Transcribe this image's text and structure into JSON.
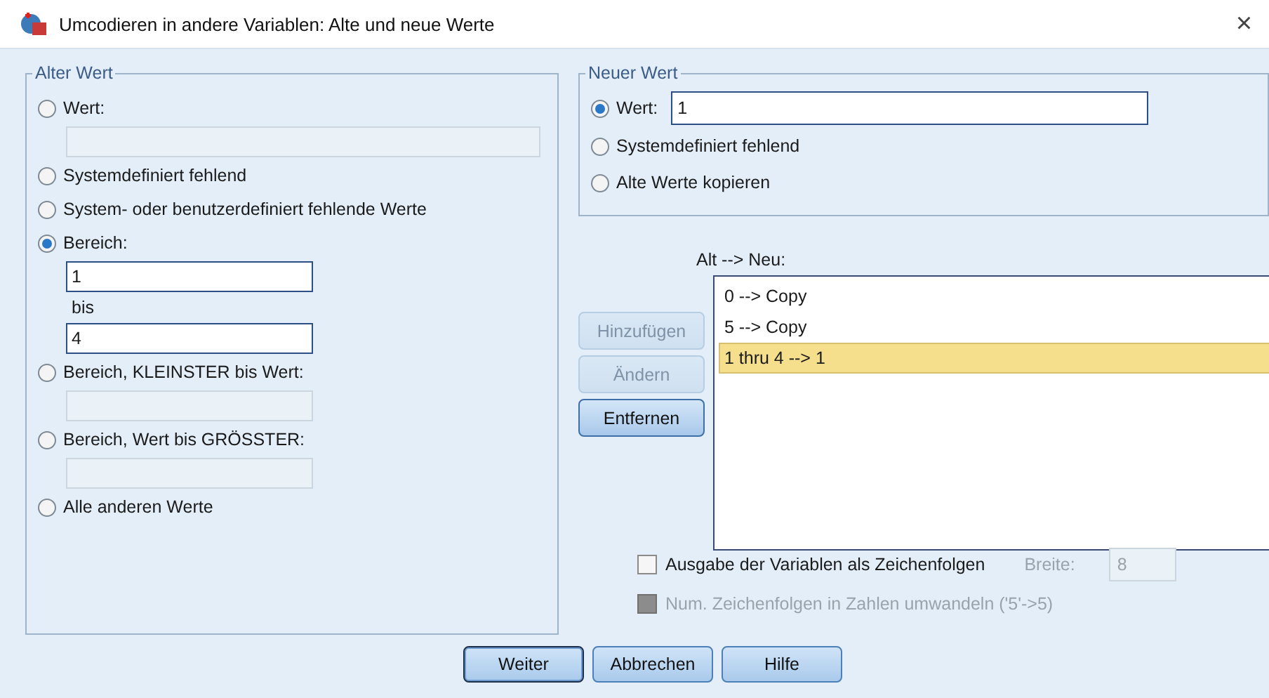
{
  "window": {
    "title": "Umcodieren in andere Variablen: Alte und neue Werte",
    "close": "×"
  },
  "old_value": {
    "title": "Alter Wert",
    "items": [
      {
        "kind": "radio",
        "label": "Wert:",
        "selected": false
      },
      {
        "kind": "field",
        "disabled": true,
        "wide": true
      },
      {
        "kind": "radio",
        "label": "Systemdefiniert fehlend",
        "selected": false
      },
      {
        "kind": "radio",
        "label": "System- oder benutzerdefiniert fehlende Werte",
        "selected": false
      },
      {
        "kind": "radio",
        "label": "Bereich:",
        "selected": true
      },
      {
        "kind": "field",
        "value": "1",
        "disabled": false,
        "wide": false
      },
      {
        "kind": "label",
        "label": "bis"
      },
      {
        "kind": "field",
        "value": "4",
        "disabled": false,
        "wide": false
      },
      {
        "kind": "radio",
        "label": "Bereich, KLEINSTER bis Wert:",
        "selected": false
      },
      {
        "kind": "field",
        "disabled": true,
        "wide": false
      },
      {
        "kind": "radio",
        "label": "Bereich, Wert bis GRÖSSTER:",
        "selected": false
      },
      {
        "kind": "field",
        "disabled": true,
        "wide": false
      },
      {
        "kind": "radio",
        "label": "Alle anderen Werte",
        "selected": false
      }
    ]
  },
  "new_value": {
    "title": "Neuer Wert",
    "items": [
      {
        "label": "Wert:",
        "selected": true,
        "value": "1"
      },
      {
        "label": "Systemdefiniert fehlend",
        "selected": false
      },
      {
        "label": "Alte Werte kopieren",
        "selected": false
      }
    ]
  },
  "mapping": {
    "label": "Alt --> Neu:",
    "buttons": [
      {
        "label": "Hinzufügen",
        "disabled": true
      },
      {
        "label": "Ändern",
        "disabled": true
      },
      {
        "label": "Entfernen",
        "disabled": false
      }
    ],
    "rows": [
      {
        "text": "0 --> Copy",
        "selected": false
      },
      {
        "text": "5 --> Copy",
        "selected": false
      },
      {
        "text": "1 thru 4 --> 1",
        "selected": true
      }
    ]
  },
  "options": [
    {
      "label": "Ausgabe der Variablen als Zeichenfolgen",
      "checked": false,
      "disabled": false,
      "width_label": "Breite:",
      "width_value": "8"
    },
    {
      "label": "Num. Zeichenfolgen in Zahlen umwandeln ('5'->5)",
      "checked": false,
      "disabled": true
    }
  ],
  "buttons": [
    {
      "label": "Weiter",
      "default": true
    },
    {
      "label": "Abbrechen",
      "default": false
    },
    {
      "label": "Hilfe",
      "default": false
    }
  ]
}
